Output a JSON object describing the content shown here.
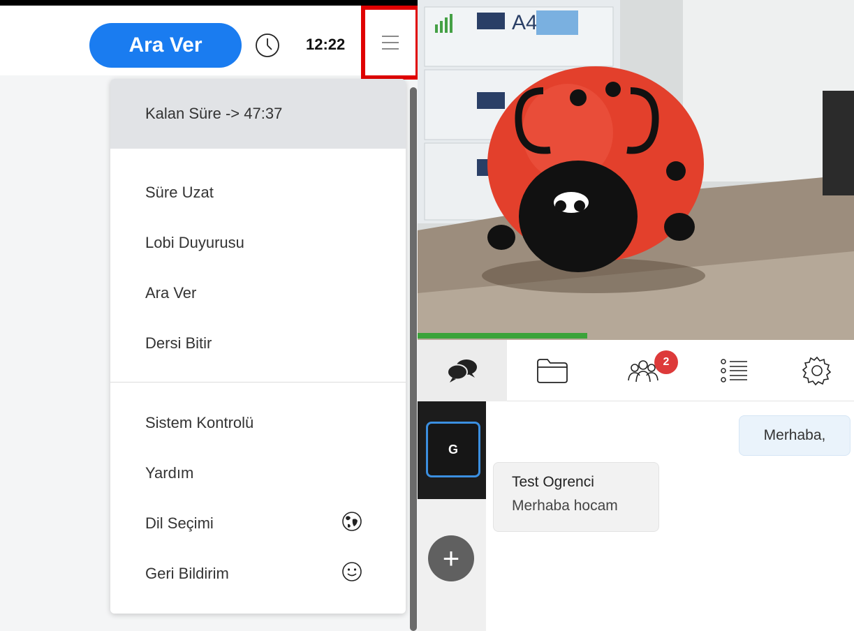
{
  "header": {
    "break_button_label": "Ara Ver",
    "time": "12:22"
  },
  "menu": {
    "remaining_time": "Kalan Süre -> 47:37",
    "section1": [
      "Süre Uzat",
      "Lobi Duyurusu",
      "Ara Ver",
      "Dersi Bitir"
    ],
    "section2": [
      "Sistem Kontrolü",
      "Yardım",
      "Dil Seçimi",
      "Geri Bildirim"
    ],
    "icons": {
      "language": "globe-icon",
      "feedback": "smiley-icon"
    }
  },
  "tabs": {
    "items": [
      "chat-icon",
      "folder-icon",
      "participants-icon",
      "list-icon",
      "settings-icon"
    ],
    "participants_badge": "2"
  },
  "chat": {
    "channel_initial": "G",
    "add_label": "+",
    "messages": [
      {
        "text": "Merhaba,"
      },
      {
        "sender": "Test Ogrenci",
        "text": "Merhaba hocam"
      }
    ]
  },
  "colors": {
    "accent": "#1a7cf0",
    "highlight": "#e00000",
    "badge": "#dd3a3a",
    "progress": "#3aa33a"
  }
}
